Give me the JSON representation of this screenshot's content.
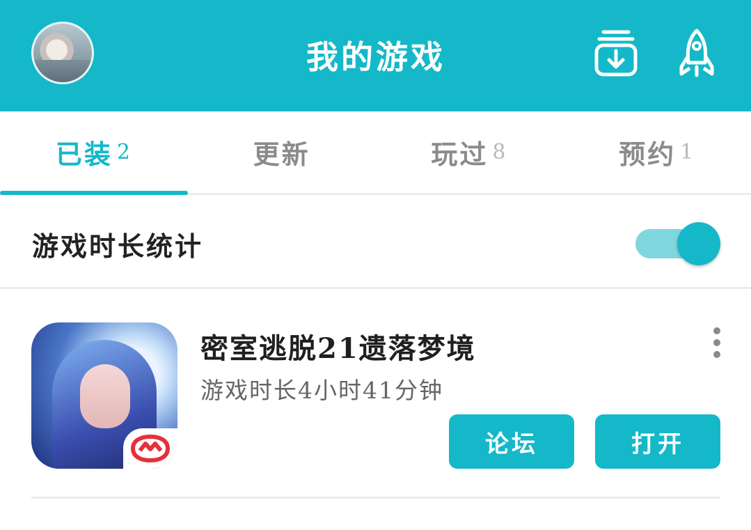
{
  "header": {
    "title": "我的游戏",
    "avatar_icon": "user-avatar",
    "download_icon": "download-box-icon",
    "rocket_icon": "rocket-icon",
    "accent_color": "#15b8c8"
  },
  "tabs": [
    {
      "label": "已装",
      "count": "2",
      "active": true
    },
    {
      "label": "更新",
      "count": "",
      "active": false
    },
    {
      "label": "玩过",
      "count": "8",
      "active": false
    },
    {
      "label": "预约",
      "count": "1",
      "active": false
    }
  ],
  "stats": {
    "label": "游戏时长统计",
    "toggle_on": true
  },
  "games": [
    {
      "name": "密室逃脱21遗落梦境",
      "play_time": "游戏时长4小时41分钟",
      "forum_label": "论坛",
      "open_label": "打开"
    }
  ]
}
